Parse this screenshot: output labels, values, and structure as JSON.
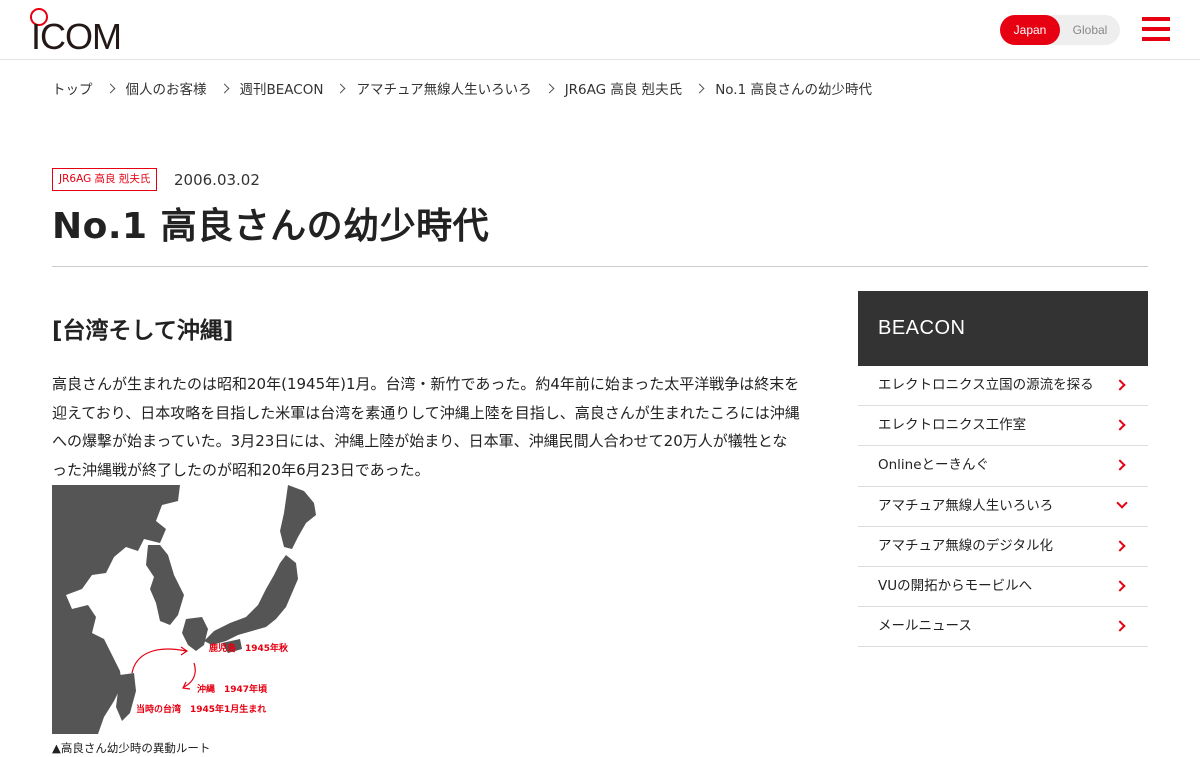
{
  "header": {
    "logo_text": "ICOM",
    "lang_japan": "Japan",
    "lang_global": "Global"
  },
  "breadcrumb": [
    "トップ",
    "個人のお客様",
    "週刊BEACON",
    "アマチュア無線人生いろいろ",
    "JR6AG 高良 剋夫氏",
    "No.1 高良さんの幼少時代"
  ],
  "article": {
    "tag": "JR6AG 高良 剋夫氏",
    "date": "2006.03.02",
    "title": "No.1 高良さんの幼少時代",
    "section_heading": "[台湾そして沖縄]",
    "paragraph": "高良さんが生まれたのは昭和20年(1945年)1月。台湾・新竹であった。約4年前に始まった太平洋戦争は終末を迎えており、日本攻略を目指した米軍は台湾を素通りして沖縄上陸を目指し、高良さんが生まれたころには沖縄への爆撃が始まっていた。3月23日には、沖縄上陸が始まり、日本軍、沖縄民間人合わせて20万人が犠牲となった沖縄戦が終了したのが昭和20年6月23日であった。",
    "map_labels": {
      "kagoshima": "鹿児島　1945年秋",
      "okinawa": "沖縄　1947年頃",
      "taiwan": "当時の台湾　1945年1月生まれ"
    },
    "caption": "▲高良さん幼少時の異動ルート"
  },
  "sidebar": {
    "title": "BEACON",
    "items": [
      {
        "label": "エレクトロニクス立国の源流を探る",
        "expanded": false
      },
      {
        "label": "エレクトロニクス工作室",
        "expanded": false
      },
      {
        "label": "Onlineとーきんぐ",
        "expanded": false
      },
      {
        "label": "アマチュア無線人生いろいろ",
        "expanded": true
      },
      {
        "label": "アマチュア無線のデジタル化",
        "expanded": false
      },
      {
        "label": "VUの開拓からモービルへ",
        "expanded": false
      },
      {
        "label": "メールニュース",
        "expanded": false
      }
    ]
  },
  "colors": {
    "accent": "#e60012",
    "sidebar_head": "#333333",
    "map_land": "#555555"
  }
}
